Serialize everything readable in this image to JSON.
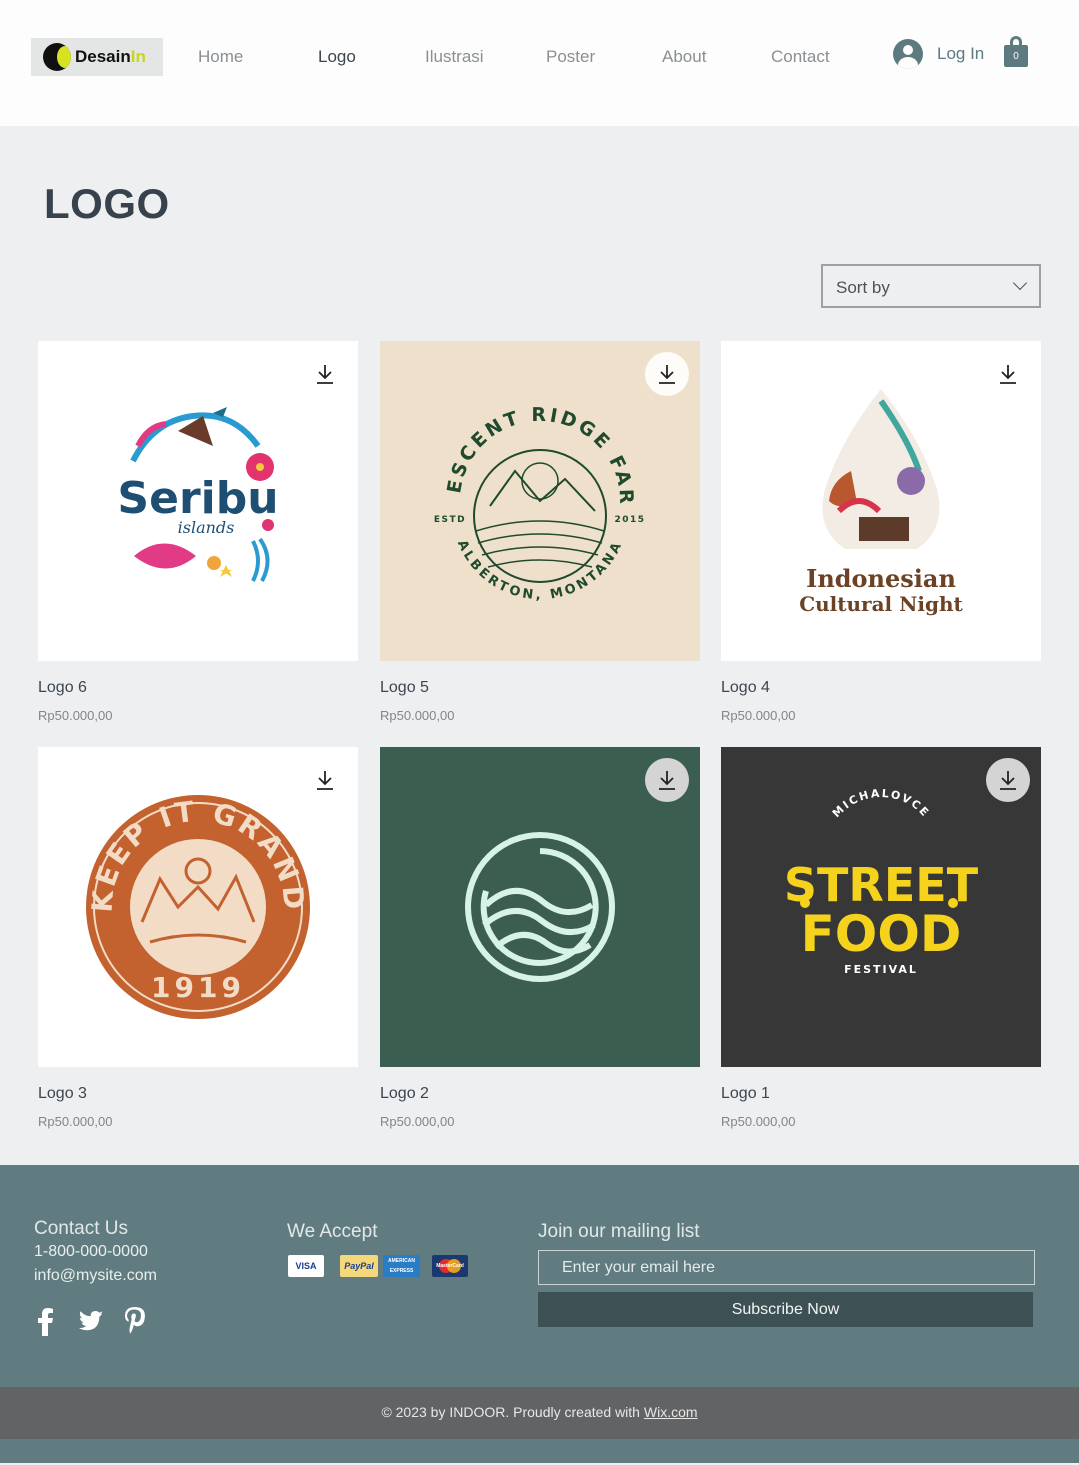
{
  "brand": {
    "name_main": "Desain",
    "name_accent": "In"
  },
  "nav": {
    "items": [
      "Home",
      "Logo",
      "Ilustrasi",
      "Poster",
      "About",
      "Contact"
    ],
    "active": "Logo"
  },
  "header": {
    "login_label": "Log In",
    "cart_count": "0"
  },
  "page": {
    "title": "LOGO",
    "sort_label": "Sort by"
  },
  "products": [
    {
      "name": "Logo 6",
      "price": "Rp50.000,00"
    },
    {
      "name": "Logo 5",
      "price": "Rp50.000,00"
    },
    {
      "name": "Logo 4",
      "price": "Rp50.000,00"
    },
    {
      "name": "Logo 3",
      "price": "Rp50.000,00"
    },
    {
      "name": "Logo 2",
      "price": "Rp50.000,00"
    },
    {
      "name": "Logo 1",
      "price": "Rp50.000,00"
    }
  ],
  "artwork": {
    "seribu": {
      "main": "Seribu",
      "sub": "islands"
    },
    "crescent": {
      "top": "CRESCENT RIDGE FARM",
      "bottom": "ALBERTON, MONTANA",
      "left": "ESTD",
      "right": "2015"
    },
    "indonesian": {
      "line1": "Indonesian",
      "line2": "Cultural Night"
    },
    "grand": {
      "top": "KEEP IT GRAND",
      "year": "1919"
    },
    "streetfood": {
      "top": "MICHALOVCE",
      "line1": "STREET",
      "line2": "FOOD",
      "bottom": "FESTIVAL"
    }
  },
  "footer": {
    "contact_title": "Contact Us",
    "phone": "1-800-000-0000",
    "email": "info@mysite.com",
    "accept_title": "We Accept",
    "payments": [
      "VISA",
      "PayPal",
      "AMERICAN EXPRESS",
      "MasterCard"
    ],
    "mailing_title": "Join our mailing list",
    "email_placeholder": "Enter your email here",
    "subscribe_label": "Subscribe Now",
    "copyright_prefix": "© 2023 by INDOOR. Proudly created with ",
    "copyright_link": "Wix.com"
  },
  "colors": {
    "accent": "#5c7a80",
    "footer_bg": "#617c80",
    "brand_yellow": "#d6e321"
  }
}
